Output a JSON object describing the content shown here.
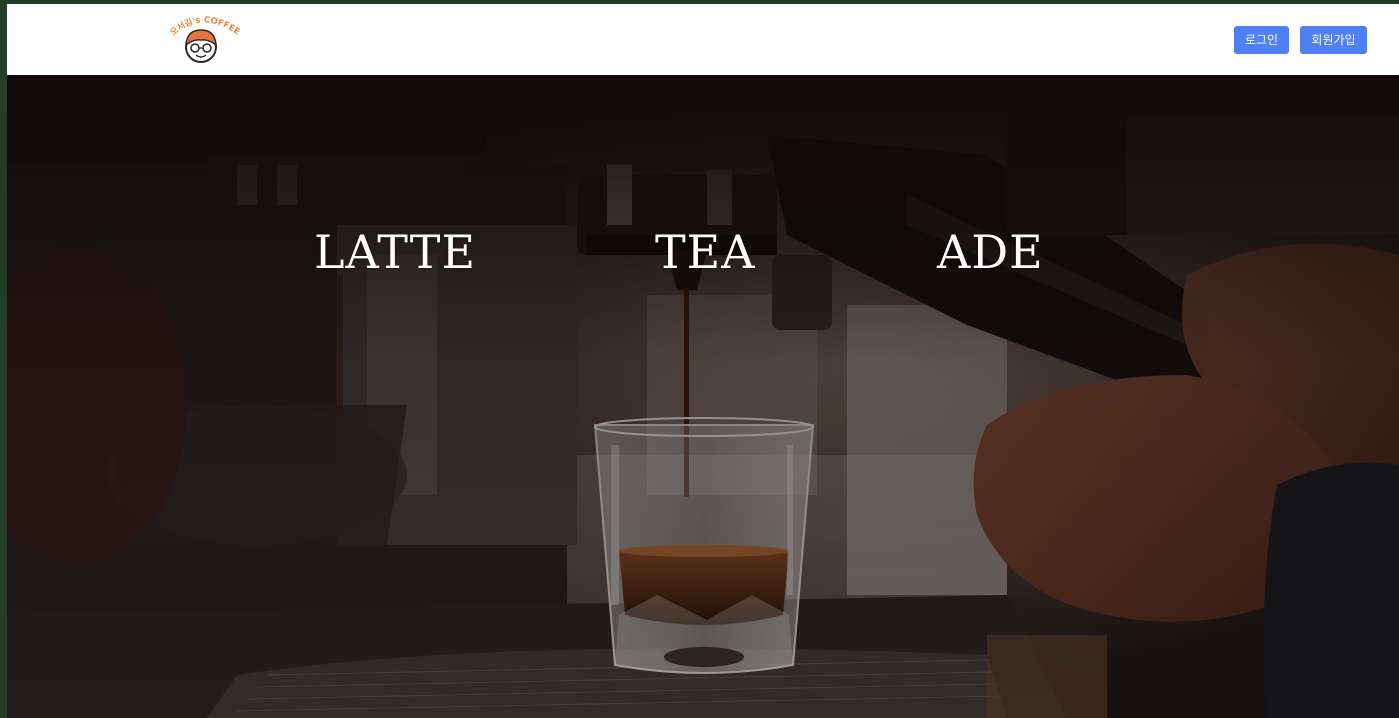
{
  "header": {
    "logo_text": "오서김's COFFEE",
    "login_label": "로그인",
    "signup_label": "회원가입"
  },
  "hero": {
    "menu": [
      {
        "label": "LATTE"
      },
      {
        "label": "TEA"
      },
      {
        "label": "ADE"
      }
    ]
  },
  "colors": {
    "page_background": "#233d28",
    "header_background": "#ffffff",
    "button_background": "#4f80f5",
    "button_text": "#ffffff",
    "hero_text": "#ffffff"
  },
  "icons": {
    "logo": "barista-face-logo"
  }
}
